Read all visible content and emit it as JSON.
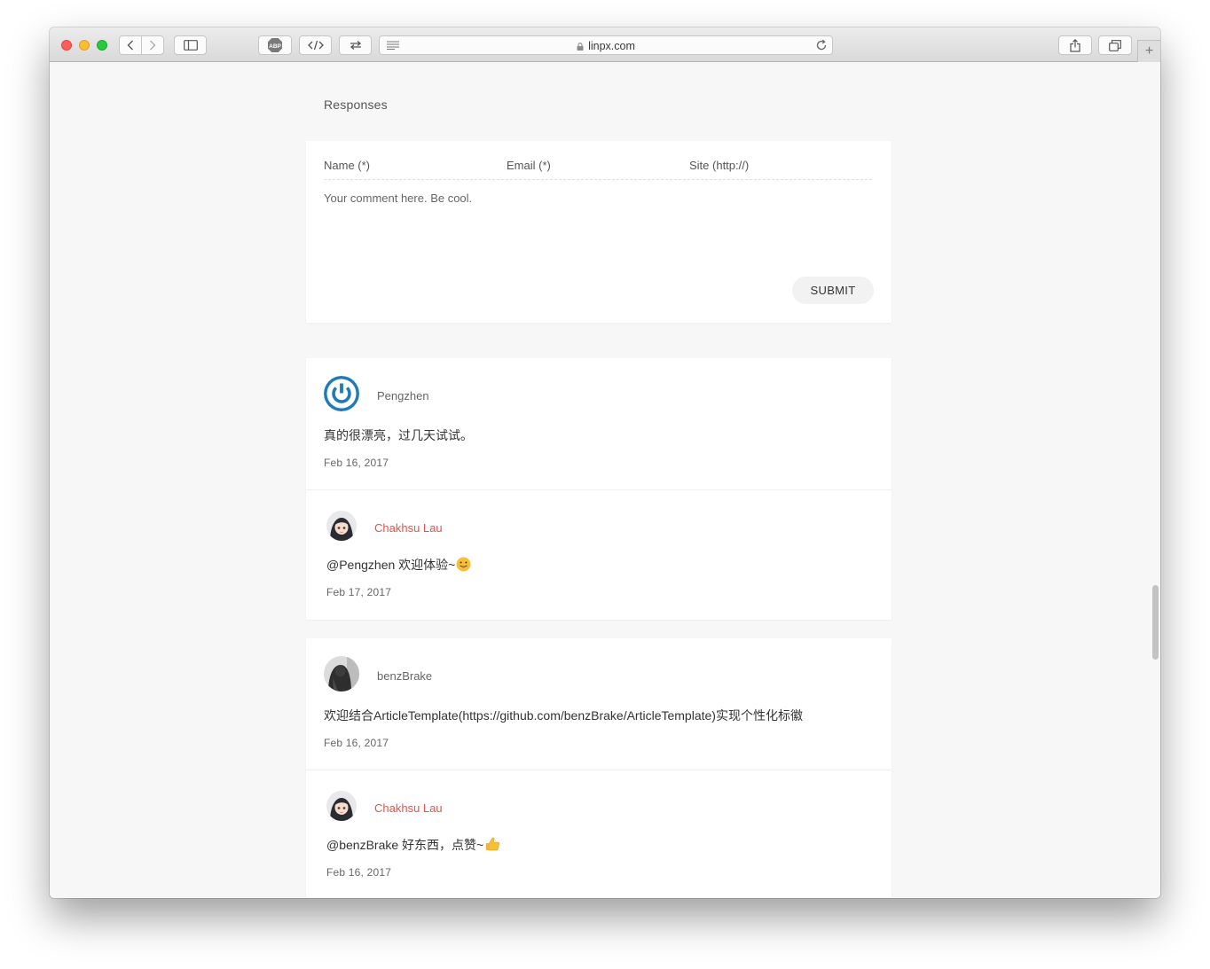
{
  "browser": {
    "url": "linpx.com",
    "adblock_label": "ABP"
  },
  "responses": {
    "title": "Responses"
  },
  "form": {
    "name_placeholder": "Name (*)",
    "email_placeholder": "Email (*)",
    "site_placeholder": "Site (http://)",
    "comment_placeholder": "Your comment here. Be cool.",
    "submit_label": "SUBMIT"
  },
  "threads": [
    {
      "comment": {
        "author": "Pengzhen",
        "text": "真的很漂亮，过几天试试。",
        "date": "Feb 16, 2017",
        "avatar": "power-icon",
        "avatar_color": "#1e7ab8"
      },
      "reply": {
        "author": "Chakhsu Lau",
        "text": "@Pengzhen 欢迎体验~",
        "emoji": "tongue-face-emoji",
        "date": "Feb 17, 2017"
      }
    },
    {
      "comment": {
        "author": "benzBrake",
        "text": "欢迎结合ArticleTemplate(https://github.com/benzBrake/ArticleTemplate)实现个性化标徽",
        "date": "Feb 16, 2017",
        "avatar": "dark-figure-avatar"
      },
      "reply": {
        "author": "Chakhsu Lau",
        "text": "@benzBrake 好东西，点赞~",
        "emoji": "thumbs-up-emoji",
        "date": "Feb 16, 2017"
      }
    }
  ],
  "colors": {
    "reply_author": "#e5534b",
    "page_background": "#f7f7f7"
  }
}
